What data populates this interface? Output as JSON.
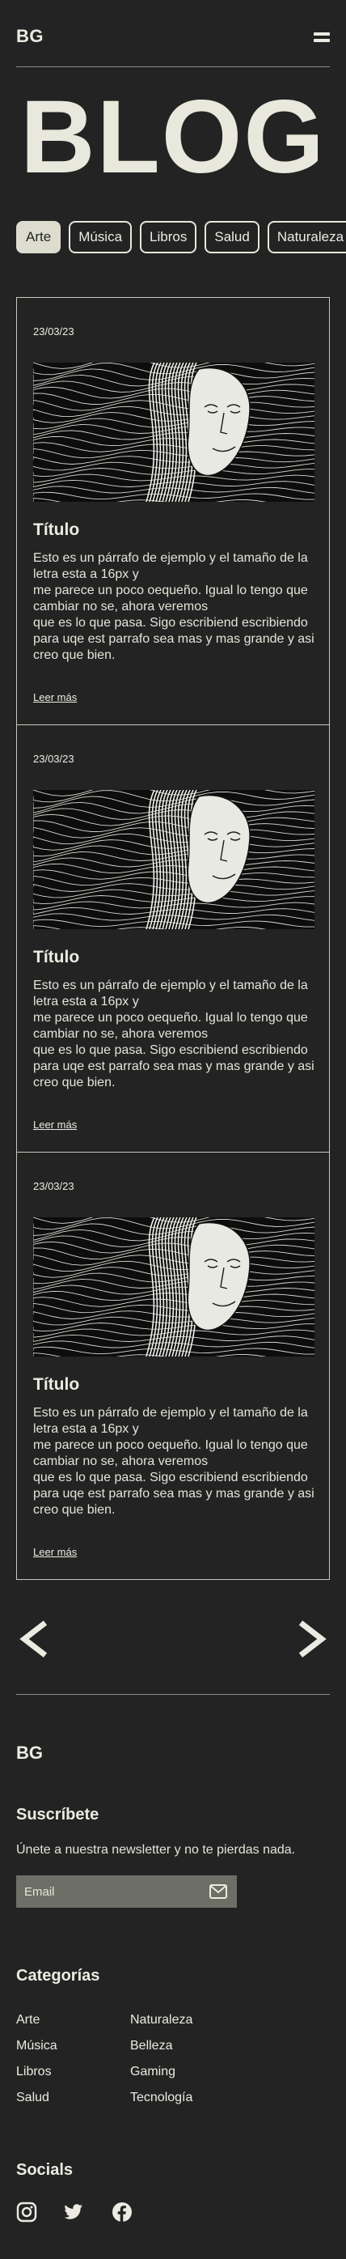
{
  "header": {
    "logo": "BG",
    "menu_icon": "hamburger-menu-icon"
  },
  "hero": {
    "title": "BLOG"
  },
  "categories_tabs": [
    {
      "label": "Arte",
      "active": true
    },
    {
      "label": "Música",
      "active": false
    },
    {
      "label": "Libros",
      "active": false
    },
    {
      "label": "Salud",
      "active": false
    },
    {
      "label": "Naturaleza",
      "active": false
    }
  ],
  "posts": [
    {
      "date": "23/03/23",
      "title": "Título",
      "body": "Esto es un párrafo de ejemplo y el tamaño de la letra esta a 16px y\nme parece un poco oequeño. Igual lo tengo que cambiar no se, ahora veremos\nque es lo que pasa. Sigo escribiend escribiendo para uqe est parrafo sea mas y mas grande y asi creo que bien.",
      "link": "Leer más"
    },
    {
      "date": "23/03/23",
      "title": "Título",
      "body": "Esto es un párrafo de ejemplo y el tamaño de la letra esta a 16px y\nme parece un poco oequeño. Igual lo tengo que cambiar no se, ahora veremos\nque es lo que pasa. Sigo escribiend escribiendo para uqe est parrafo sea mas y mas grande y asi creo que bien.",
      "link": "Leer más"
    },
    {
      "date": "23/03/23",
      "title": "Título",
      "body": "Esto es un párrafo de ejemplo y el tamaño de la letra esta a 16px y\nme parece un poco oequeño. Igual lo tengo que cambiar no se, ahora veremos\nque es lo que pasa. Sigo escribiend escribiendo para uqe est parrafo sea mas y mas grande y asi creo que bien.",
      "link": "Leer más"
    }
  ],
  "pagination": {
    "prev_icon": "chevron-left-icon",
    "next_icon": "chevron-right-icon"
  },
  "footer": {
    "logo": "BG",
    "subscribe": {
      "heading": "Suscríbete",
      "text": "Únete a nuestra newsletter y no te pierdas nada.",
      "placeholder": "Email",
      "button_icon": "mail-icon"
    },
    "categories": {
      "heading": "Categorías",
      "col1": [
        "Arte",
        "Música",
        "Libros",
        "Salud"
      ],
      "col2": [
        "Naturaleza",
        "Belleza",
        "Gaming",
        "Tecnología"
      ]
    },
    "socials": {
      "heading": "Socials",
      "icons": [
        "instagram-icon",
        "twitter-icon",
        "facebook-icon"
      ]
    }
  },
  "colors": {
    "background": "#232323",
    "text": "#ecebe2",
    "tab_active": "#dcdccf",
    "input_bg": "#6d6e66"
  }
}
